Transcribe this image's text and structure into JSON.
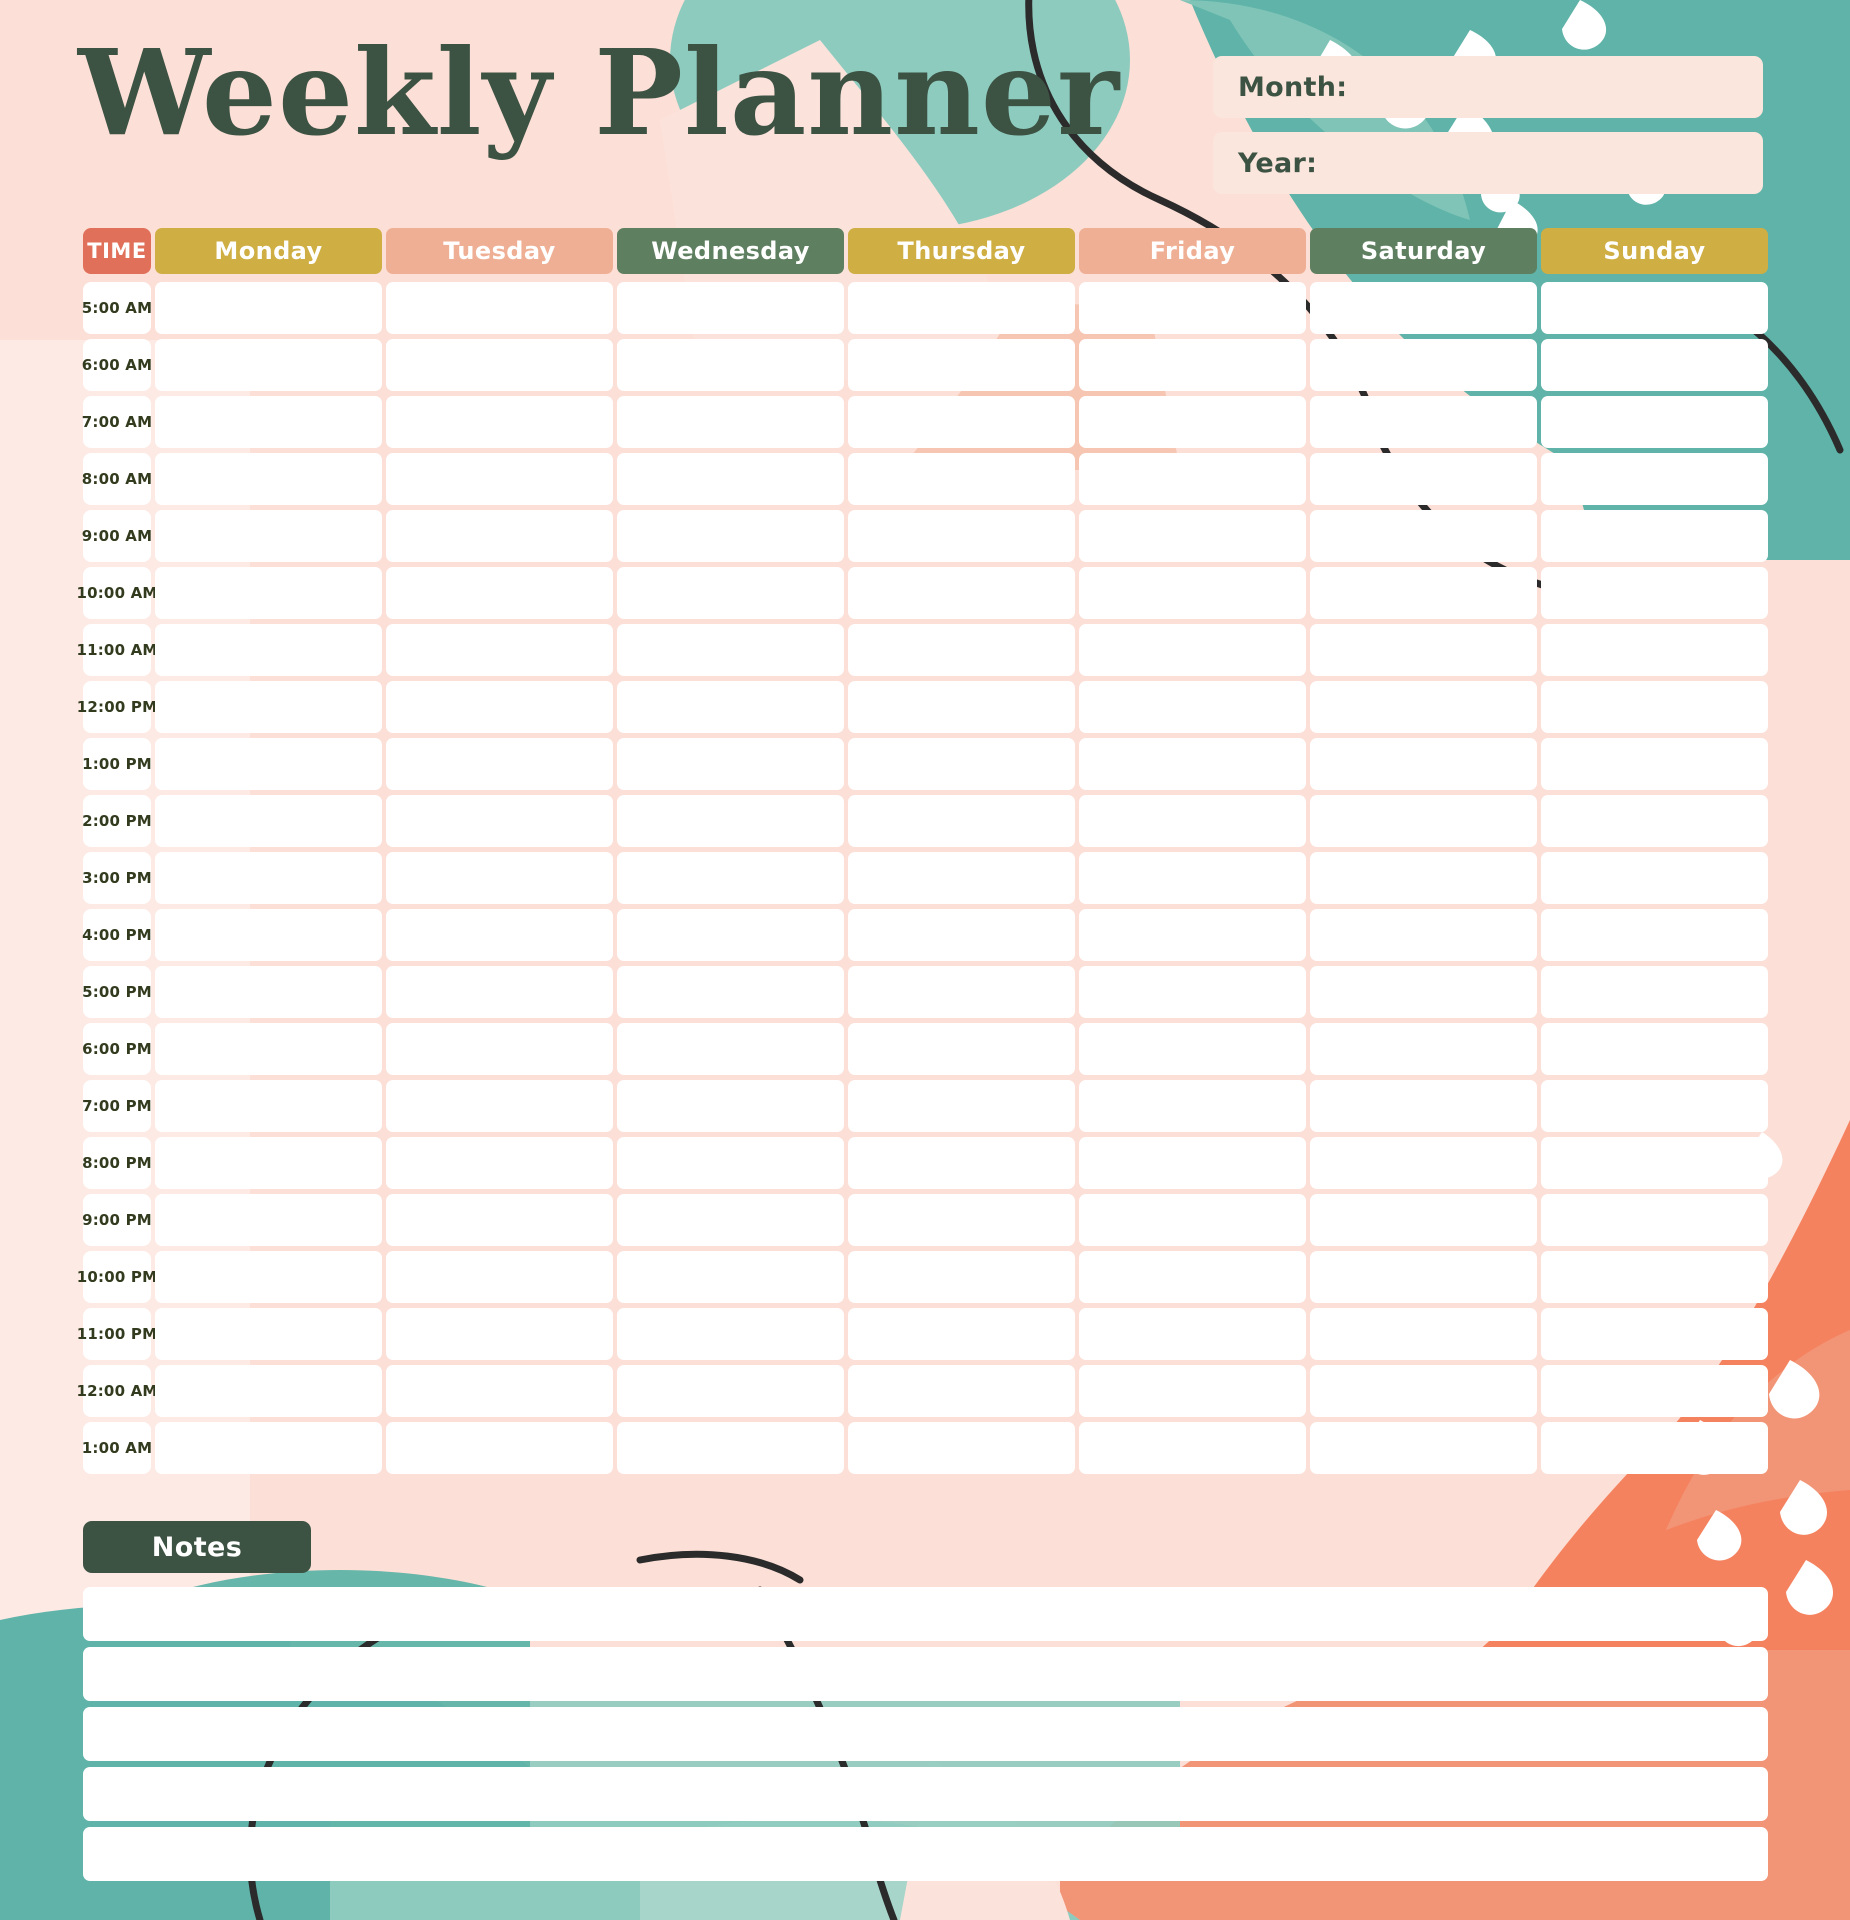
{
  "page": {
    "title": "Weekly Planner",
    "background_color": "#FCDFD6",
    "title_color": "#3C5243"
  },
  "meta": {
    "month_label": "Month:",
    "month_value": "",
    "year_label": "Year:",
    "year_value": "",
    "field_bg": "#FAE6DC"
  },
  "schedule": {
    "time_header": "TIME",
    "time_header_color": "#E0705A",
    "columns": [
      {
        "label": "Monday",
        "color": "#CFAE44"
      },
      {
        "label": "Tuesday",
        "color": "#EFAF94"
      },
      {
        "label": "Wednesday",
        "color": "#5F8060"
      },
      {
        "label": "Thursday",
        "color": "#CFAE44"
      },
      {
        "label": "Friday",
        "color": "#EFAF94"
      },
      {
        "label": "Saturday",
        "color": "#5F8060"
      },
      {
        "label": "Sunday",
        "color": "#CFAE44"
      }
    ],
    "times": [
      "5:00 AM",
      "6:00 AM",
      "7:00 AM",
      "8:00 AM",
      "9:00 AM",
      "10:00 AM",
      "11:00 AM",
      "12:00 PM",
      "1:00 PM",
      "2:00 PM",
      "3:00 PM",
      "4:00 PM",
      "5:00 PM",
      "6:00 PM",
      "7:00 PM",
      "8:00 PM",
      "9:00 PM",
      "10:00 PM",
      "11:00 PM",
      "12:00 AM",
      "1:00 AM"
    ],
    "entries": [
      [
        "",
        "",
        "",
        "",
        "",
        "",
        ""
      ],
      [
        "",
        "",
        "",
        "",
        "",
        "",
        ""
      ],
      [
        "",
        "",
        "",
        "",
        "",
        "",
        ""
      ],
      [
        "",
        "",
        "",
        "",
        "",
        "",
        ""
      ],
      [
        "",
        "",
        "",
        "",
        "",
        "",
        ""
      ],
      [
        "",
        "",
        "",
        "",
        "",
        "",
        ""
      ],
      [
        "",
        "",
        "",
        "",
        "",
        "",
        ""
      ],
      [
        "",
        "",
        "",
        "",
        "",
        "",
        ""
      ],
      [
        "",
        "",
        "",
        "",
        "",
        "",
        ""
      ],
      [
        "",
        "",
        "",
        "",
        "",
        "",
        ""
      ],
      [
        "",
        "",
        "",
        "",
        "",
        "",
        ""
      ],
      [
        "",
        "",
        "",
        "",
        "",
        "",
        ""
      ],
      [
        "",
        "",
        "",
        "",
        "",
        "",
        ""
      ],
      [
        "",
        "",
        "",
        "",
        "",
        "",
        ""
      ],
      [
        "",
        "",
        "",
        "",
        "",
        "",
        ""
      ],
      [
        "",
        "",
        "",
        "",
        "",
        "",
        ""
      ],
      [
        "",
        "",
        "",
        "",
        "",
        "",
        ""
      ],
      [
        "",
        "",
        "",
        "",
        "",
        "",
        ""
      ],
      [
        "",
        "",
        "",
        "",
        "",
        "",
        ""
      ],
      [
        "",
        "",
        "",
        "",
        "",
        "",
        ""
      ],
      [
        "",
        "",
        "",
        "",
        "",
        "",
        ""
      ]
    ]
  },
  "notes": {
    "label": "Notes",
    "label_bg": "#3C5243",
    "lines": [
      "",
      "",
      "",
      "",
      ""
    ]
  },
  "decor": {
    "teal": "#5FB3A8",
    "teal_light": "#8ECBBF",
    "teal_pale": "#A8D5CA",
    "coral": "#F5825F",
    "coral_light": "#F29476",
    "pink_light": "#FBE3DC",
    "pink_pale": "#FDEAE4",
    "ink": "#2B2B2B",
    "petal": "#FFFFFF"
  }
}
